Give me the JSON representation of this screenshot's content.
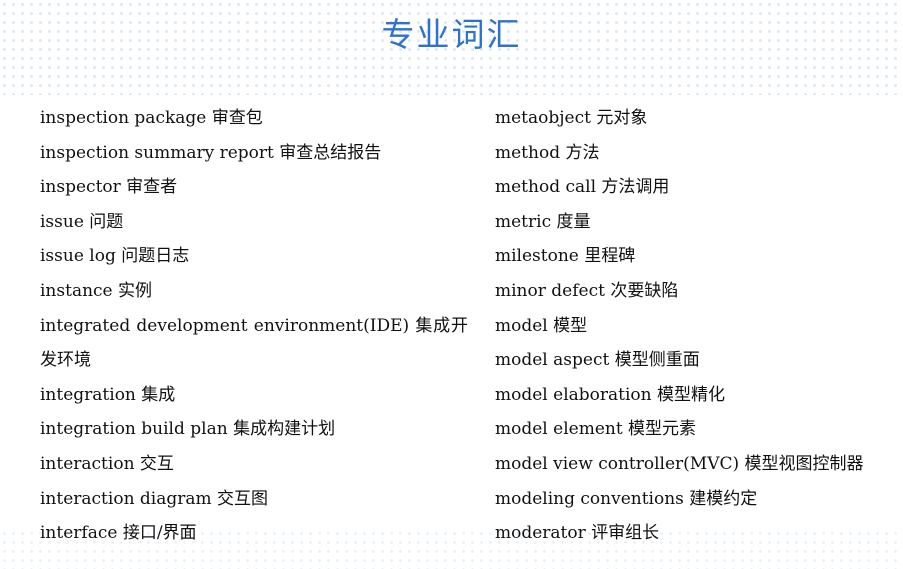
{
  "title": "专业词汇",
  "left_terms": [
    "inspection package 审查包",
    "inspection summary report 审查总结报告",
    "inspector 审查者",
    "issue 问题",
    "issue log 问题日志",
    "instance 实例",
    "integrated development environment(IDE) 集成开",
    "发环境",
    "integration 集成",
    "integration build plan 集成构建计划",
    "interaction 交互",
    "interaction diagram 交互图",
    "interface 接口/界面"
  ],
  "right_terms": [
    "metaobject 元对象",
    "method 方法",
    "method call 方法调用",
    "metric 度量",
    "milestone 里程碑",
    "minor defect 次要缺陷",
    "model 模型",
    "model aspect 模型侧重面",
    "model elaboration 模型精化",
    "model element 模型元素",
    "model view controller(MVC) 模型视图控制器",
    "modeling conventions 建模约定",
    "moderator 评审组长"
  ]
}
